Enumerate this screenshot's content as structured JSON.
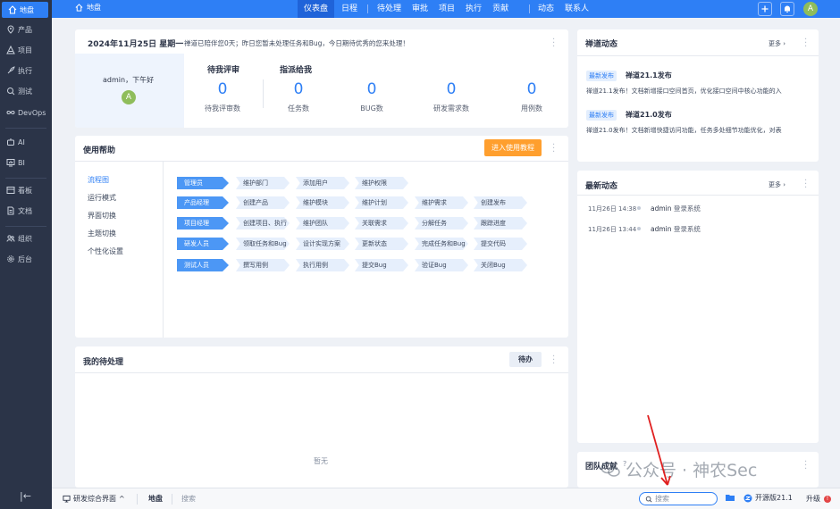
{
  "sidebar": {
    "items": [
      {
        "label": "地盘",
        "icon": "home-icon"
      },
      {
        "label": "产品",
        "icon": "location-pin-icon"
      },
      {
        "label": "项目",
        "icon": "project-icon"
      },
      {
        "label": "执行",
        "icon": "rocket-icon"
      },
      {
        "label": "测试",
        "icon": "test-search-icon"
      },
      {
        "label": "DevOps",
        "icon": "infinity-icon"
      },
      {
        "label": "AI",
        "icon": "robot-icon"
      },
      {
        "label": "BI",
        "icon": "chart-screen-icon"
      },
      {
        "label": "看板",
        "icon": "kanban-icon"
      },
      {
        "label": "文档",
        "icon": "document-icon"
      },
      {
        "label": "组织",
        "icon": "team-icon"
      },
      {
        "label": "后台",
        "icon": "gear-icon"
      }
    ],
    "collapse_label": "|←"
  },
  "topbar": {
    "breadcrumb": "地盘",
    "nav": [
      "仪表盘",
      "日程",
      "待处理",
      "审批",
      "项目",
      "执行",
      "贡献",
      "动态",
      "联系人"
    ],
    "active_nav": "仪表盘",
    "avatar": "A"
  },
  "welcome": {
    "date": "2024年11月25日 星期一",
    "message": "禅道已陪伴您0天；昨日您暂未处理任务和Bug，今日期待优秀的您来处理！",
    "greeting": "admin，下午好",
    "avatar": "A",
    "review_header": "待我评审",
    "assign_header": "指派给我",
    "stats": [
      {
        "value": "0",
        "label": "待我评审数"
      },
      {
        "value": "0",
        "label": "任务数"
      },
      {
        "value": "0",
        "label": "BUG数"
      },
      {
        "value": "0",
        "label": "研发需求数"
      },
      {
        "value": "0",
        "label": "用例数"
      }
    ]
  },
  "help": {
    "title": "使用帮助",
    "enter_button": "进入使用教程",
    "nav": [
      "流程图",
      "运行模式",
      "界面切换",
      "主题切换",
      "个性化设置"
    ],
    "rows": [
      {
        "role": "管理员",
        "steps": [
          "维护部门",
          "添加用户",
          "维护权限"
        ]
      },
      {
        "role": "产品经理",
        "steps": [
          "创建产品",
          "维护模块",
          "维护计划",
          "维护需求",
          "创建发布"
        ]
      },
      {
        "role": "项目经理",
        "steps": [
          "创建项目、执行",
          "维护团队",
          "关联需求",
          "分解任务",
          "跟踪进度"
        ]
      },
      {
        "role": "研发人员",
        "steps": [
          "领取任务和Bug",
          "设计实现方案",
          "更新状态",
          "完成任务和Bug",
          "提交代码"
        ]
      },
      {
        "role": "测试人员",
        "steps": [
          "撰写用例",
          "执行用例",
          "提交Bug",
          "验证Bug",
          "关闭Bug"
        ]
      }
    ]
  },
  "todo": {
    "title": "我的待处理",
    "tab": "待办",
    "empty": "暂无"
  },
  "zentao_news": {
    "title": "禅道动态",
    "more": "更多",
    "items": [
      {
        "badge": "最新发布",
        "title": "禅道21.1发布",
        "desc": "禅道21.1发布！文档新增接口空间首页，优化接口空间中核心功能的入"
      },
      {
        "badge": "最新发布",
        "title": "禅道21.0发布",
        "desc": "禅道21.0发布！文档新增快捷访问功能，任务多处细节功能优化，对表"
      }
    ]
  },
  "latest": {
    "title": "最新动态",
    "more": "更多",
    "items": [
      {
        "time": "11月26日 14:38",
        "user": "admin",
        "action": "登录系统"
      },
      {
        "time": "11月26日 13:44",
        "user": "admin",
        "action": "登录系统"
      }
    ]
  },
  "team": {
    "title": "团队成就"
  },
  "bottombar": {
    "interface": "研发综合界面",
    "crumb_active": "地盘",
    "crumb_search": "搜索",
    "search_placeholder": "搜索",
    "version": "开源版21.1",
    "upgrade": "升级"
  },
  "watermark": "公众号 · 神农Sec",
  "colors": {
    "primary": "#2e7ff5",
    "sidebar": "#2b3448",
    "accent_orange": "#ff9f2e"
  }
}
